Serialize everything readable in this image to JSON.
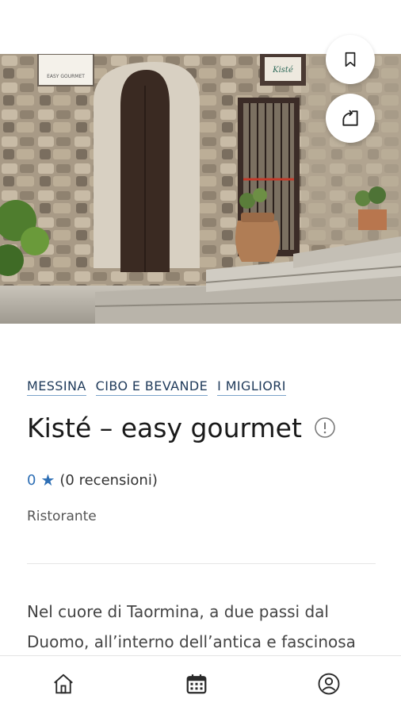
{
  "place": {
    "chips": [
      "MESSINA",
      "CIBO E BEVANDE",
      "I MIGLIORI"
    ],
    "title": "Kisté – easy gourmet",
    "rating_value": "0",
    "rating_count": "(0 recensioni)",
    "type": "Ristorante",
    "description": "Nel cuore di Taormina, a due passi dal Duomo, all’interno dell’antica e fascinosa"
  },
  "hero": {
    "sign_main": "Kisté",
    "sign_small": "EASY GOURMET"
  },
  "icons": {
    "bookmark": "bookmark-icon",
    "share": "share-icon",
    "info": "info-icon",
    "star": "star-icon",
    "home": "home-icon",
    "calendar": "calendar-icon",
    "user": "user-icon"
  },
  "colors": {
    "accent": "#2e6fb5",
    "chip_underline": "#7aa3c9"
  }
}
